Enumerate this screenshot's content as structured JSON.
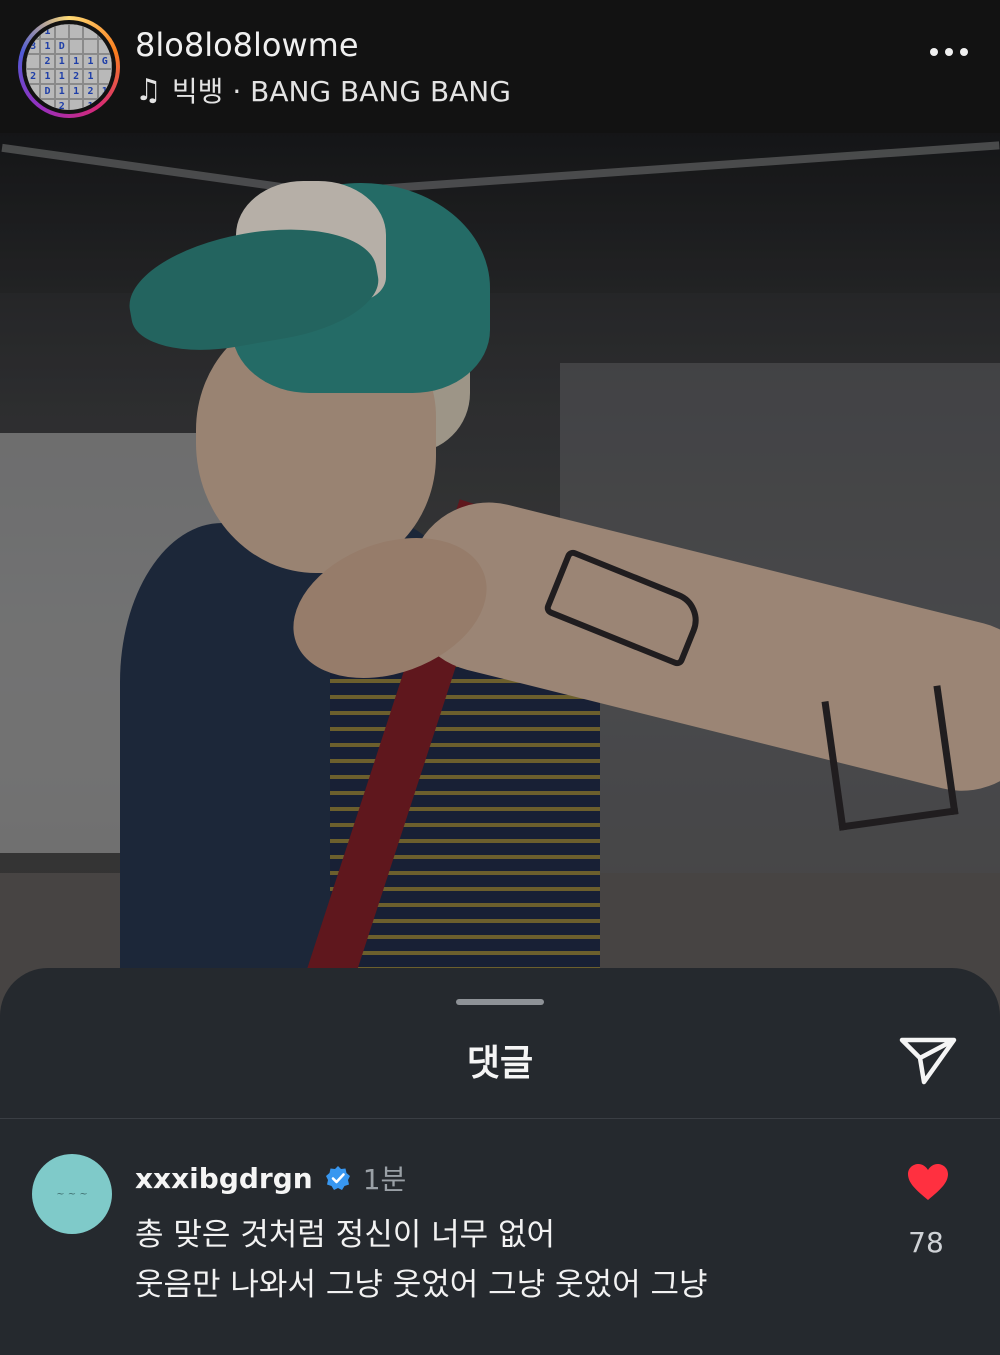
{
  "post": {
    "username": "8lo8lo8lowme",
    "music": {
      "icon": "music-note-icon",
      "text": "빅뱅 · BANG BANG BANG"
    },
    "more_icon": "more-horizontal-icon",
    "avatar_digits": [
      "1",
      "1",
      "",
      "",
      "",
      "",
      "3",
      "1",
      "D",
      "",
      "",
      "",
      "",
      "2",
      "1",
      "1",
      "1",
      "G",
      "2",
      "1",
      "1",
      "2",
      "1",
      "",
      "",
      "D",
      "1",
      "1",
      "2",
      "1",
      "",
      "",
      "2",
      "",
      "1",
      ""
    ]
  },
  "photo": {
    "description_icon": "post-photo"
  },
  "comments_sheet": {
    "title": "댓글",
    "share_icon": "send-icon",
    "colors": {
      "sheet_bg": "#25292e",
      "like": "#ff3040",
      "verified": "#3897f0"
    },
    "comment": {
      "username": "xxxibgdrgn",
      "verified_icon": "verified-badge-icon",
      "time": "1분",
      "line1": "총 맞은 것처럼 정신이 너무 없어",
      "line2": "웃음만 나와서 그냥 웃었어 그냥 웃었어 그냥",
      "like_icon": "heart-filled-icon",
      "like_count": "78"
    }
  }
}
